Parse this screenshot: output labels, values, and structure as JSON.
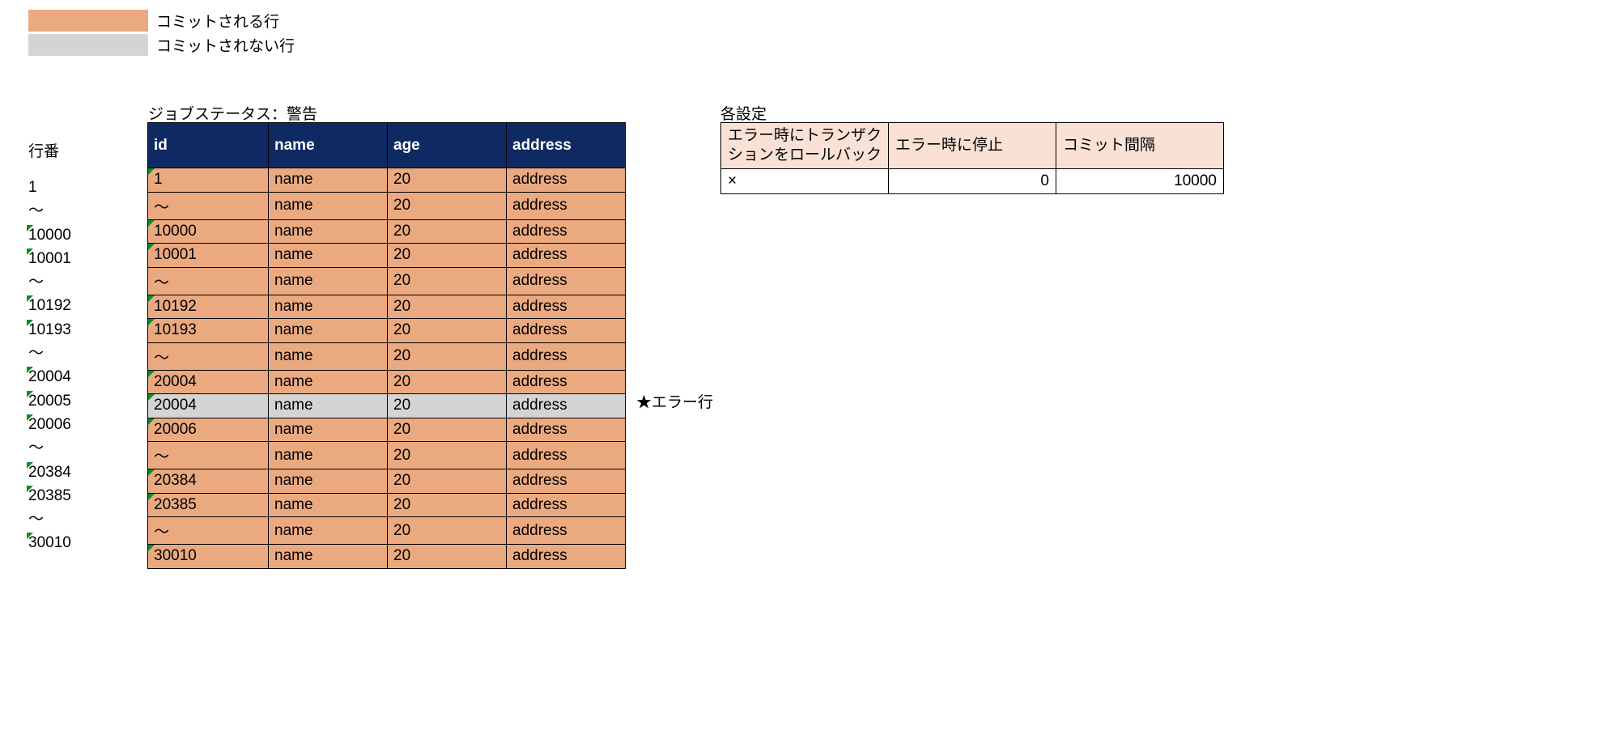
{
  "legend": {
    "committed": "コミットされる行",
    "not_committed": "コミットされない行"
  },
  "job_status_label": "ジョブステータス：警告",
  "row_label_header": "行番",
  "columns": {
    "id": "id",
    "name": "name",
    "age": "age",
    "address": "address"
  },
  "rows": [
    {
      "rownum": "1",
      "mark": false,
      "id": "1",
      "name": "name",
      "age": "20",
      "address": "address",
      "commit": true,
      "cellmark": true
    },
    {
      "rownum": "～",
      "mark": false,
      "id": "～",
      "name": "name",
      "age": "20",
      "address": "address",
      "commit": true,
      "cellmark": false
    },
    {
      "rownum": "10000",
      "mark": true,
      "id": "10000",
      "name": "name",
      "age": "20",
      "address": "address",
      "commit": true,
      "cellmark": true
    },
    {
      "rownum": "10001",
      "mark": true,
      "id": "10001",
      "name": "name",
      "age": "20",
      "address": "address",
      "commit": true,
      "cellmark": true
    },
    {
      "rownum": "～",
      "mark": false,
      "id": "～",
      "name": "name",
      "age": "20",
      "address": "address",
      "commit": true,
      "cellmark": false
    },
    {
      "rownum": "10192",
      "mark": true,
      "id": "10192",
      "name": "name",
      "age": "20",
      "address": "address",
      "commit": true,
      "cellmark": true
    },
    {
      "rownum": "10193",
      "mark": true,
      "id": "10193",
      "name": "name",
      "age": "20",
      "address": "address",
      "commit": true,
      "cellmark": true
    },
    {
      "rownum": "～",
      "mark": false,
      "id": "～",
      "name": "name",
      "age": "20",
      "address": "address",
      "commit": true,
      "cellmark": false
    },
    {
      "rownum": "20004",
      "mark": true,
      "id": "20004",
      "name": "name",
      "age": "20",
      "address": "address",
      "commit": true,
      "cellmark": true
    },
    {
      "rownum": "20005",
      "mark": true,
      "id": "20004",
      "name": "name",
      "age": "20",
      "address": "address",
      "commit": false,
      "cellmark": true
    },
    {
      "rownum": "20006",
      "mark": true,
      "id": "20006",
      "name": "name",
      "age": "20",
      "address": "address",
      "commit": true,
      "cellmark": true
    },
    {
      "rownum": "～",
      "mark": false,
      "id": "～",
      "name": "name",
      "age": "20",
      "address": "address",
      "commit": true,
      "cellmark": false
    },
    {
      "rownum": "20384",
      "mark": true,
      "id": "20384",
      "name": "name",
      "age": "20",
      "address": "address",
      "commit": true,
      "cellmark": true
    },
    {
      "rownum": "20385",
      "mark": true,
      "id": "20385",
      "name": "name",
      "age": "20",
      "address": "address",
      "commit": true,
      "cellmark": true
    },
    {
      "rownum": "～",
      "mark": false,
      "id": "～",
      "name": "name",
      "age": "20",
      "address": "address",
      "commit": true,
      "cellmark": false
    },
    {
      "rownum": "30010",
      "mark": true,
      "id": "30010",
      "name": "name",
      "age": "20",
      "address": "address",
      "commit": true,
      "cellmark": true
    }
  ],
  "error_row_label": "★エラー行",
  "settings": {
    "title": "各設定",
    "headers": {
      "rollback": "エラー時にトランザクションをロールバック",
      "stop": "エラー時に停止",
      "interval": "コミット間隔"
    },
    "values": {
      "rollback": "×",
      "stop": "0",
      "interval": "10000"
    }
  }
}
